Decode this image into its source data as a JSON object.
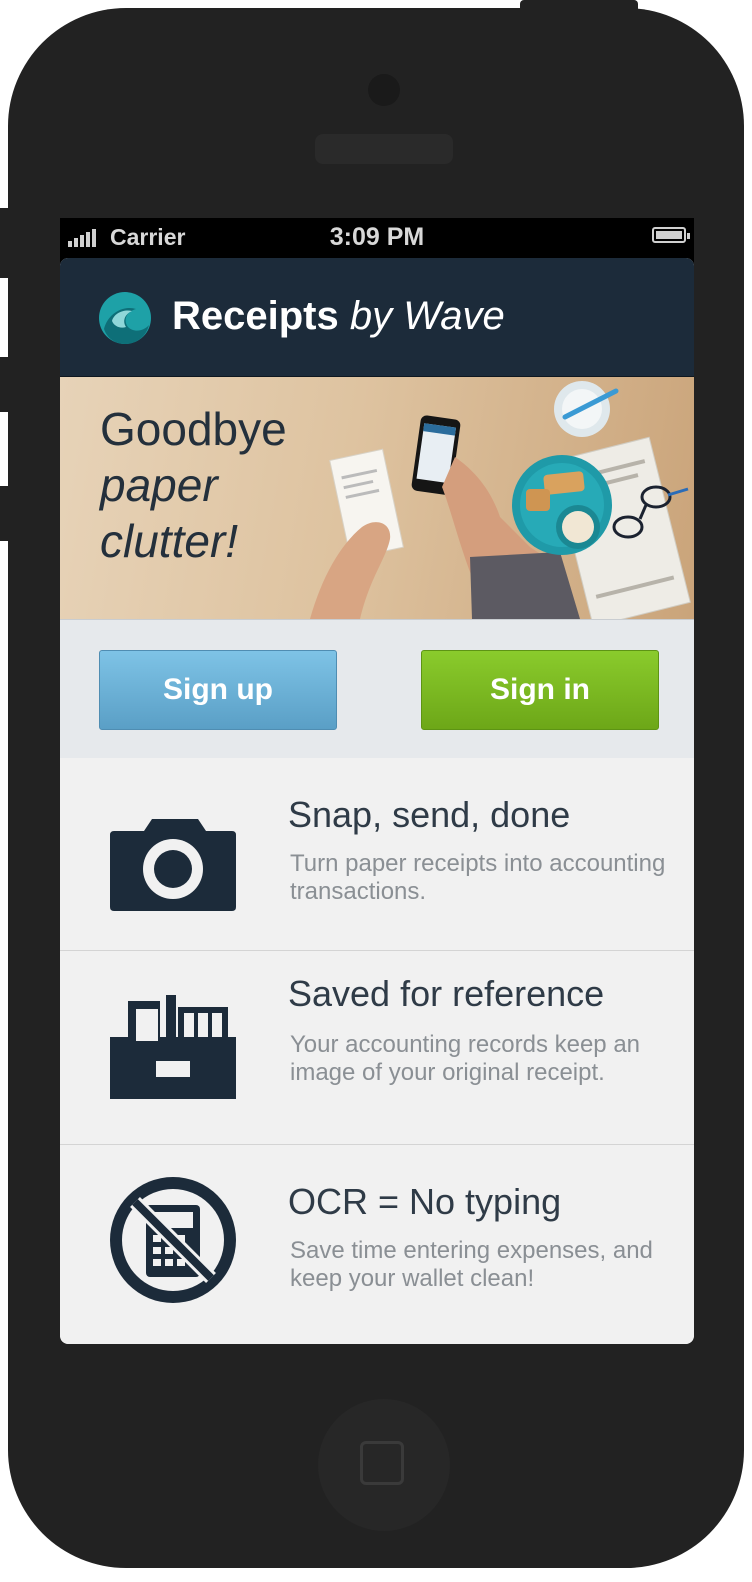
{
  "status_bar": {
    "carrier": "Carrier",
    "time": "3:09 PM"
  },
  "header": {
    "title_bold": "Receipts",
    "title_italic": "by Wave"
  },
  "hero": {
    "line1": "Goodbye",
    "line2": "paper",
    "line3": "clutter!"
  },
  "actions": {
    "sign_up": "Sign up",
    "sign_in": "Sign in"
  },
  "features": [
    {
      "title": "Snap, send, done",
      "description": "Turn paper receipts into accounting transactions.",
      "icon": "camera-icon"
    },
    {
      "title": "Saved for reference",
      "description": "Your accounting records keep an image of your original receipt.",
      "icon": "filing-box-icon"
    },
    {
      "title": "OCR = No typing",
      "description": "Save time entering expenses, and keep your wallet clean!",
      "icon": "no-calculator-icon"
    }
  ],
  "colors": {
    "header_bg": "#1c2b3a",
    "sign_up": "#6aafd6",
    "sign_in": "#7ab824",
    "icon": "#1c2b3a",
    "logo": "#1ea1a7"
  }
}
